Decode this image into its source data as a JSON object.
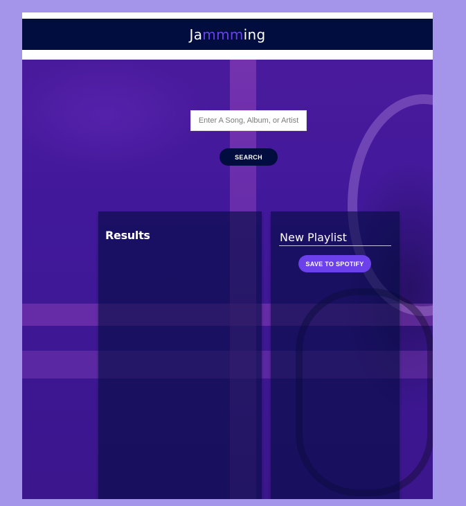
{
  "header": {
    "logo_part1": "Ja",
    "logo_accent": "mmm",
    "logo_part2": "ing"
  },
  "search": {
    "placeholder": "Enter A Song, Album, or Artist",
    "value": "",
    "button_label": "SEARCH"
  },
  "results": {
    "title": "Results",
    "tracks": []
  },
  "playlist": {
    "name": "New Playlist",
    "save_label": "SAVE TO SPOTIFY",
    "tracks": []
  },
  "colors": {
    "page_background": "#a494ea",
    "header_background": "#010c3f",
    "accent": "#6c41ec",
    "panel_background": "#010c3f"
  },
  "icons": {
    "background_art": "headphones-on-wall-image"
  }
}
